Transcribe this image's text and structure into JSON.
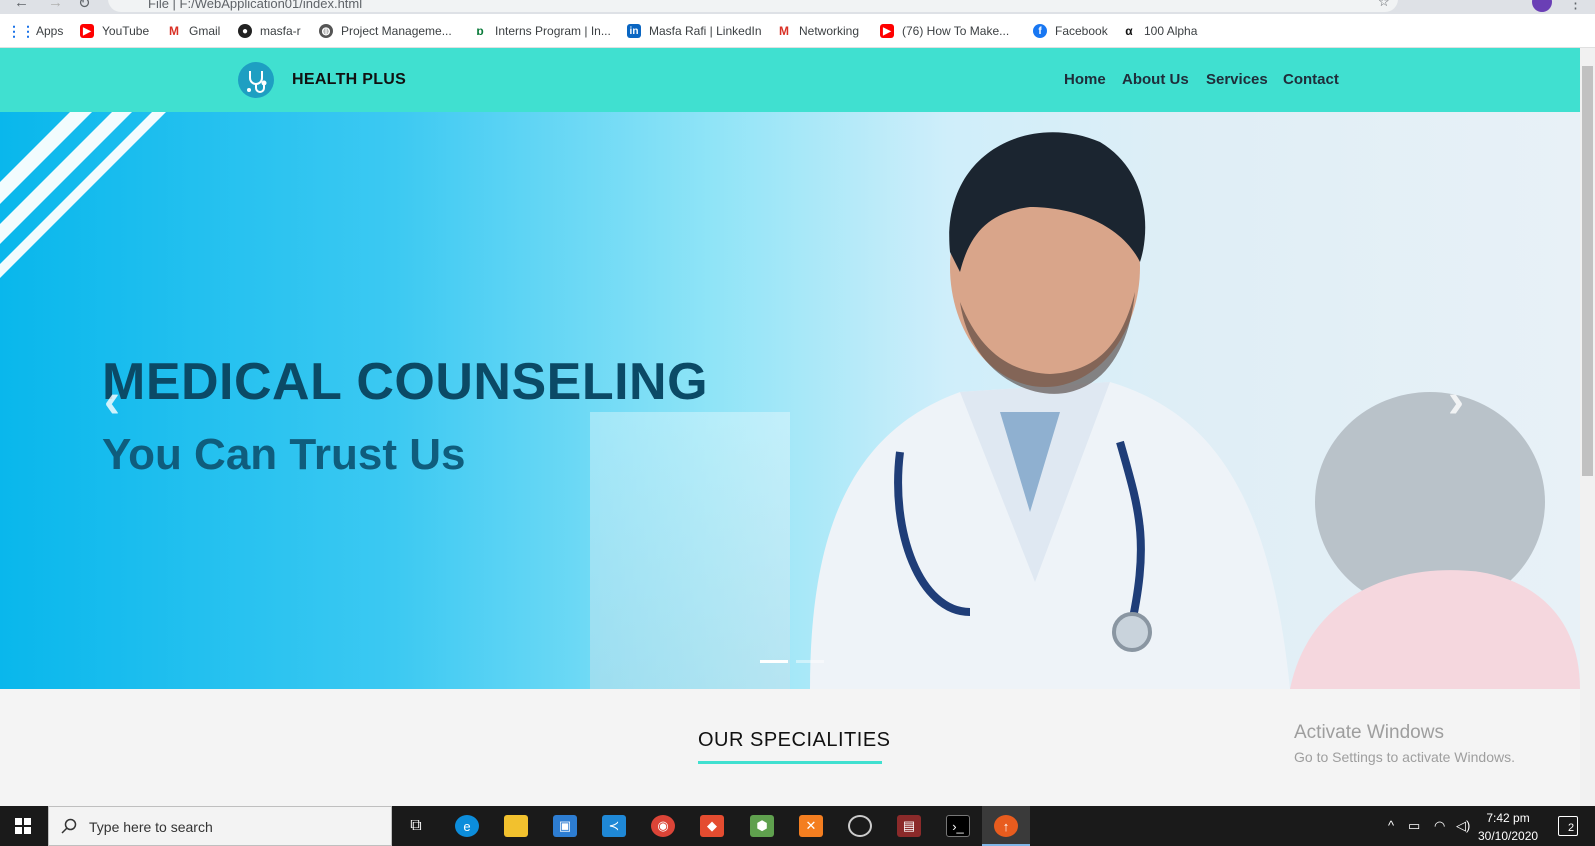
{
  "browser": {
    "url": "File | F:/WebApplication01/index.html",
    "bookmarks": [
      {
        "label": "Apps",
        "icon": "apps-grid-icon"
      },
      {
        "label": "YouTube",
        "icon": "youtube-icon"
      },
      {
        "label": "Gmail",
        "icon": "gmail-icon"
      },
      {
        "label": "masfa-r",
        "icon": "github-icon"
      },
      {
        "label": "Project Manageme...",
        "icon": "globe-icon"
      },
      {
        "label": "Interns Program | In...",
        "icon": "interns-icon"
      },
      {
        "label": "Masfa Rafi | LinkedIn",
        "icon": "linkedin-icon"
      },
      {
        "label": "Networking",
        "icon": "gmail-icon"
      },
      {
        "label": "(76) How To Make...",
        "icon": "youtube-icon"
      },
      {
        "label": "Facebook",
        "icon": "facebook-icon"
      },
      {
        "label": "100 Alpha",
        "icon": "alpha-icon"
      }
    ]
  },
  "site": {
    "brand": "HEALTH PLUS",
    "nav": [
      "Home",
      "About Us",
      "Services",
      "Contact"
    ],
    "hero": {
      "title": "MEDICAL COUNSELING",
      "subtitle": "You Can Trust Us",
      "prev_arrow": "‹",
      "next_arrow": "›"
    },
    "section_title": "OUR SPECIALITIES",
    "accent_color": "#40e0d0"
  },
  "watermark": {
    "line1": "Activate Windows",
    "line2": "Go to Settings to activate Windows."
  },
  "taskbar": {
    "search_placeholder": "Type here to search",
    "time": "7:42 pm",
    "date": "30/10/2020",
    "notifications": "2"
  }
}
